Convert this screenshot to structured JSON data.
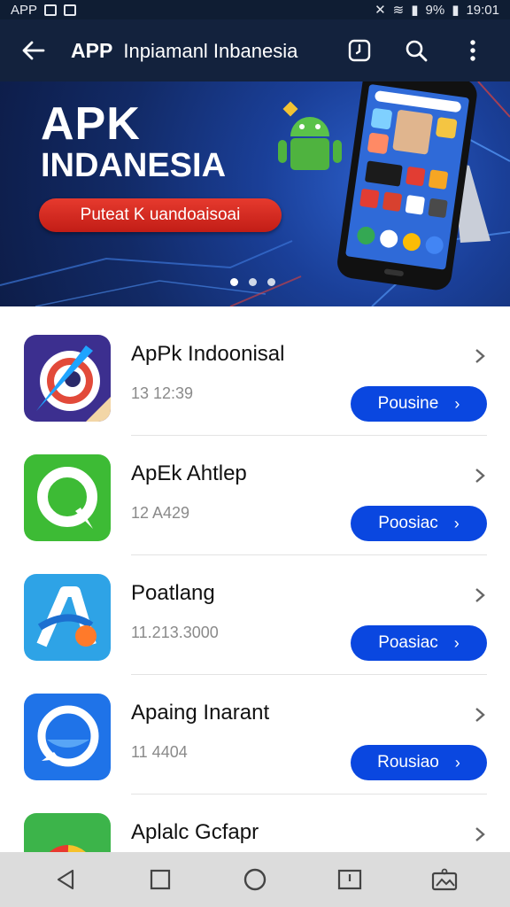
{
  "status_bar": {
    "app": "APP",
    "battery": "9%",
    "time": "19:01"
  },
  "app_bar": {
    "title_bold": "APP",
    "title_rest": "Inpiamanl Inbanesia"
  },
  "banner": {
    "heading_1": "APK",
    "heading_2": "INDANESIA",
    "cta_label": "Puteat K uandoaisoai",
    "page_count": 3,
    "active_page": 0
  },
  "apps": [
    {
      "name": "ApPk Indoonisal",
      "meta": "13 12:39",
      "button": "Pousine"
    },
    {
      "name": "ApEk Ahtlep",
      "meta": "12 A429",
      "button": "Poosiac"
    },
    {
      "name": "Poatlang",
      "meta": "11.213.3000",
      "button": "Poasiac"
    },
    {
      "name": "Apaing Inarant",
      "meta": "11 4404",
      "button": "Rousiao"
    },
    {
      "name": "Aplalc Gcfapr",
      "meta": "",
      "button": ""
    }
  ],
  "colors": {
    "app_bar": "#13223d",
    "banner": "#1a3f98",
    "accent_button": "#0a47e0",
    "cta_red": "#d4251c"
  },
  "icons": [
    "back-arrow-icon",
    "clock-icon",
    "search-icon",
    "more-vertical-icon",
    "chevron-right-icon",
    "nav-back-icon",
    "nav-recents-icon",
    "nav-home-icon",
    "nav-screenshot-icon",
    "nav-gallery-icon"
  ]
}
